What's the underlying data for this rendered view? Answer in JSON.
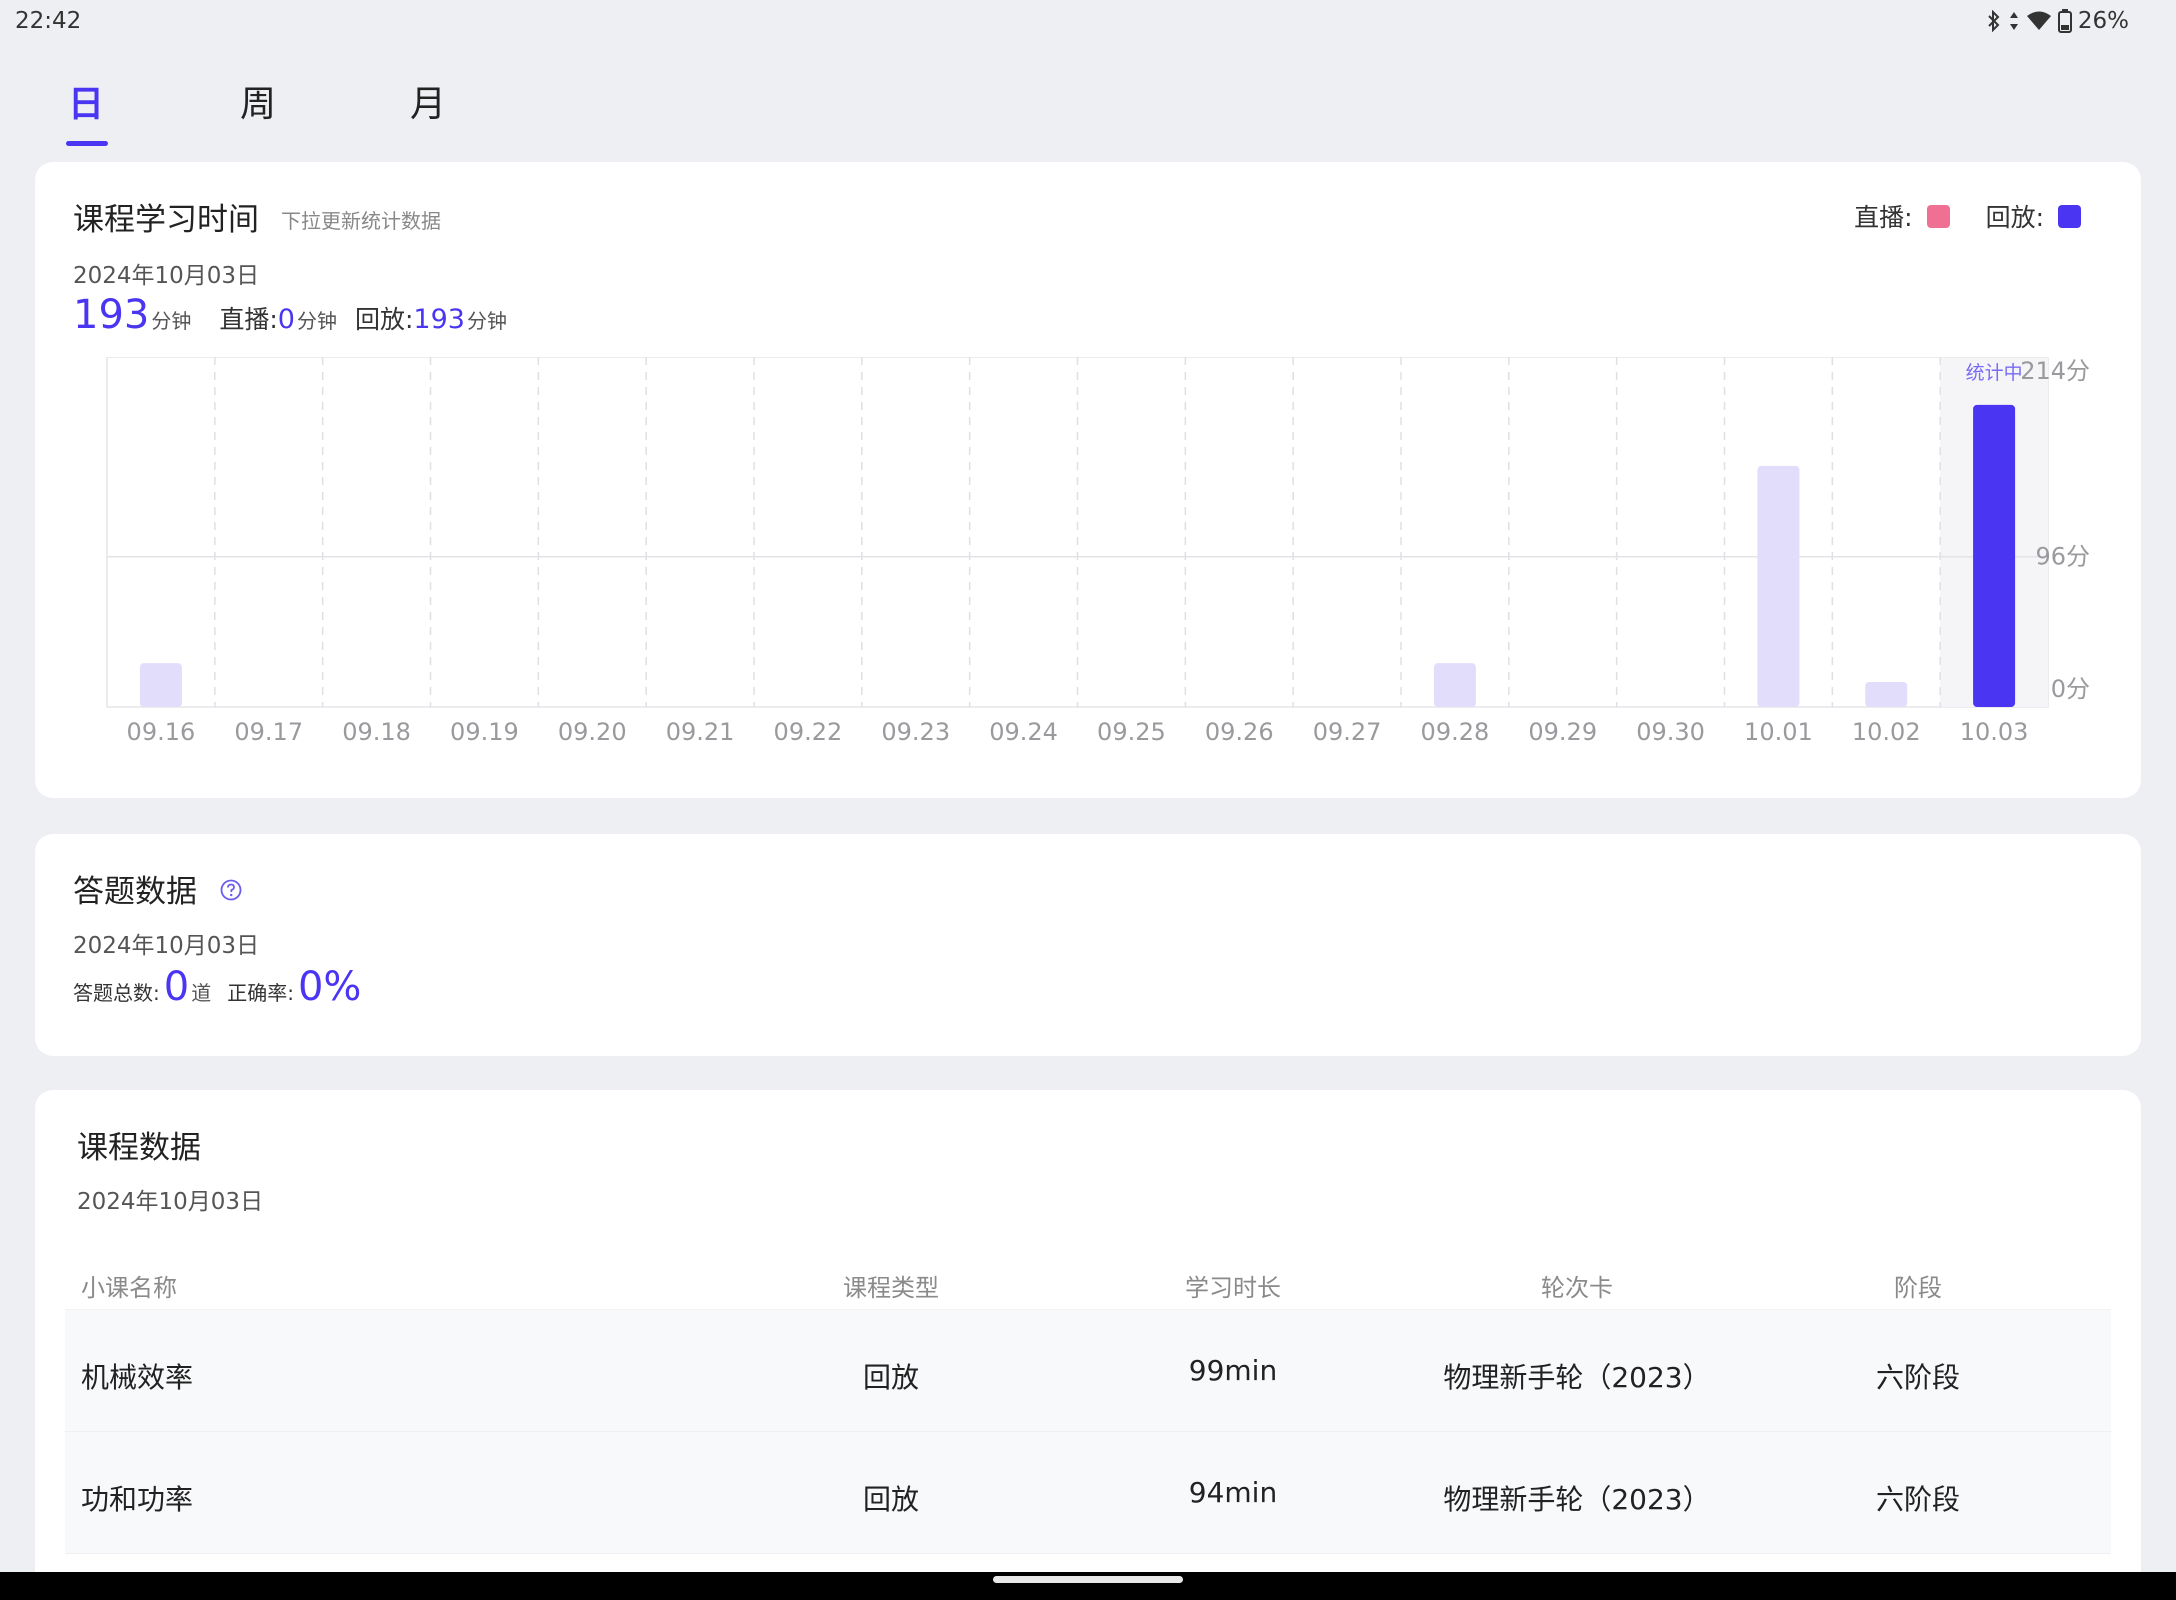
{
  "status_bar": {
    "time": "22:42",
    "battery": "26%"
  },
  "tabs": [
    {
      "label": "日",
      "active": true
    },
    {
      "label": "周",
      "active": false
    },
    {
      "label": "月",
      "active": false
    }
  ],
  "study_time": {
    "title": "课程学习时间",
    "hint": "下拉更新统计数据",
    "legend_live": "直播:",
    "legend_replay": "回放:",
    "date": "2024年10月03日",
    "total": "193",
    "total_unit": "分钟",
    "live_label": "直播:",
    "live_value": "0",
    "live_unit": "分钟",
    "replay_label": "回放:",
    "replay_value": "193",
    "replay_unit": "分钟",
    "colors": {
      "live": "#f07093",
      "replay": "#4a36f2",
      "bar_light": "#e2ddfb"
    }
  },
  "chart_data": {
    "type": "bar",
    "categories": [
      "09.16",
      "09.17",
      "09.18",
      "09.19",
      "09.20",
      "09.21",
      "09.22",
      "09.23",
      "09.24",
      "09.25",
      "09.26",
      "09.27",
      "09.28",
      "09.29",
      "09.30",
      "10.01",
      "10.02",
      "10.03"
    ],
    "values": [
      28,
      0,
      0,
      0,
      0,
      0,
      0,
      0,
      0,
      0,
      0,
      0,
      28,
      0,
      0,
      154,
      16,
      193
    ],
    "highlight_index": 17,
    "highlight_label": "统计中",
    "ytick_labels": [
      "214分",
      "96分",
      "0分"
    ],
    "ylim": [
      0,
      214
    ],
    "grid": true
  },
  "quiz": {
    "title": "答题数据",
    "date": "2024年10月03日",
    "total_label": "答题总数:",
    "total_value": "0",
    "total_unit": "道",
    "accuracy_label": "正确率:",
    "accuracy_value": "0%"
  },
  "course": {
    "title": "课程数据",
    "date": "2024年10月03日",
    "headers": [
      "小课名称",
      "课程类型",
      "学习时长",
      "轮次卡",
      "阶段"
    ],
    "rows": [
      [
        "机械效率",
        "回放",
        "99min",
        "物理新手轮（2023）",
        "六阶段"
      ],
      [
        "功和功率",
        "回放",
        "94min",
        "物理新手轮（2023）",
        "六阶段"
      ]
    ]
  }
}
